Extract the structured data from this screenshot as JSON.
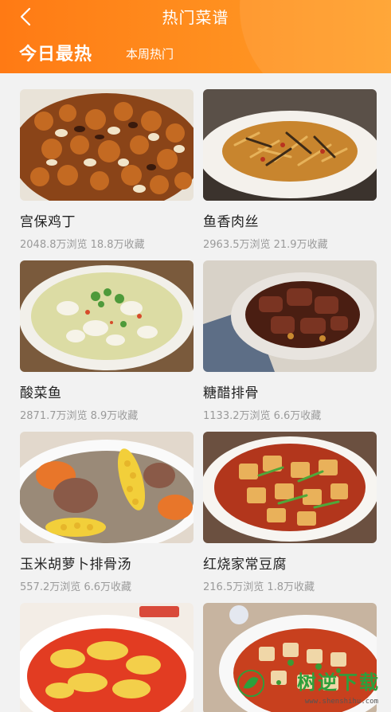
{
  "header": {
    "title": "热门菜谱",
    "tabs": [
      {
        "label": "今日最热",
        "active": true
      },
      {
        "label": "本周热门",
        "active": false
      }
    ],
    "accent_color": "#ff7a14"
  },
  "recipes": [
    {
      "name": "宫保鸡丁",
      "stats": "2048.8万浏览 18.8万收藏",
      "image": "kung-pao-chicken"
    },
    {
      "name": "鱼香肉丝",
      "stats": "2963.5万浏览 21.9万收藏",
      "image": "yuxiang-shredded-pork"
    },
    {
      "name": "酸菜鱼",
      "stats": "2871.7万浏览 8.9万收藏",
      "image": "pickled-cabbage-fish"
    },
    {
      "name": "糖醋排骨",
      "stats": "1133.2万浏览 6.6万收藏",
      "image": "sweet-sour-ribs"
    },
    {
      "name": "玉米胡萝卜排骨汤",
      "stats": "557.2万浏览 6.6万收藏",
      "image": "corn-carrot-rib-soup"
    },
    {
      "name": "红烧家常豆腐",
      "stats": "216.5万浏览 1.8万收藏",
      "image": "braised-tofu"
    },
    {
      "name": "",
      "stats": "",
      "image": "tomato-egg"
    },
    {
      "name": "",
      "stats": "",
      "image": "mapo-tofu"
    }
  ],
  "watermark": {
    "text": "树逆下载",
    "url": "www.shenshihu.com"
  }
}
